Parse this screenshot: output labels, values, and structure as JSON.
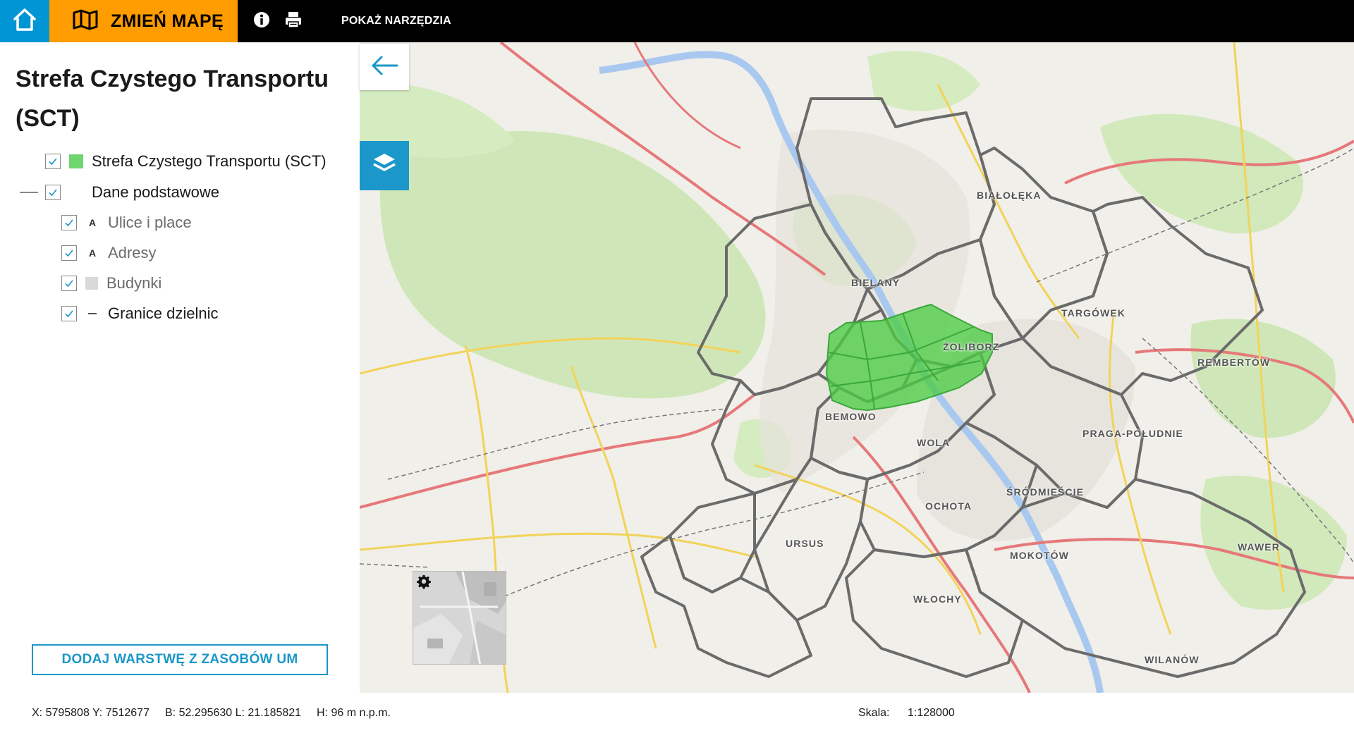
{
  "topbar": {
    "change_map_label": "ZMIEŃ MAPĘ",
    "tools_label": "POKAŻ NARZĘDZIA",
    "icons": [
      "home-icon",
      "map-icon",
      "info-icon",
      "print-icon"
    ]
  },
  "panel": {
    "title": "Strefa Czystego Transportu (SCT)",
    "layers": [
      {
        "label": "Strefa Czystego Transportu (SCT)",
        "checked": true,
        "symbol": "green-fill",
        "color": "#6ed66e"
      },
      {
        "label": "Dane podstawowe",
        "checked": true,
        "symbol": "none",
        "group": true
      },
      {
        "label": "Ulice i place",
        "checked": true,
        "symbol": "A",
        "muted": true
      },
      {
        "label": "Adresy",
        "checked": true,
        "symbol": "A",
        "muted": true
      },
      {
        "label": "Budynki",
        "checked": true,
        "symbol": "grey-fill",
        "muted": true,
        "color": "#d9d9d9"
      },
      {
        "label": "Granice dzielnic",
        "checked": true,
        "symbol": "line"
      }
    ],
    "add_layer_label": "DODAJ WARSTWĘ Z ZASOBÓW UM"
  },
  "map": {
    "districts": [
      "BIAŁOŁĘKA",
      "BIELANY",
      "TARGÓWEK",
      "ŻOLIBORZ",
      "REMBERTÓW",
      "BEMOWO",
      "WOLA",
      "PRAGA-POŁUDNIE",
      "ŚRÓDMIEŚCIE",
      "OCHOTA",
      "URSUS",
      "MOKOTÓW",
      "WAWER",
      "WŁOCHY",
      "WILANÓW"
    ],
    "zone_color": "#4ccc44"
  },
  "status": {
    "xy": "X: 5795808 Y: 7512677",
    "bl": "B: 52.295630 L: 21.185821",
    "h": "H: 96 m n.p.m.",
    "scale_label": "Skala:",
    "scale_value": "1:128000"
  },
  "colors": {
    "brand_blue": "#1b97c9",
    "home_blue": "#0095d4",
    "orange": "#ff9c00"
  }
}
